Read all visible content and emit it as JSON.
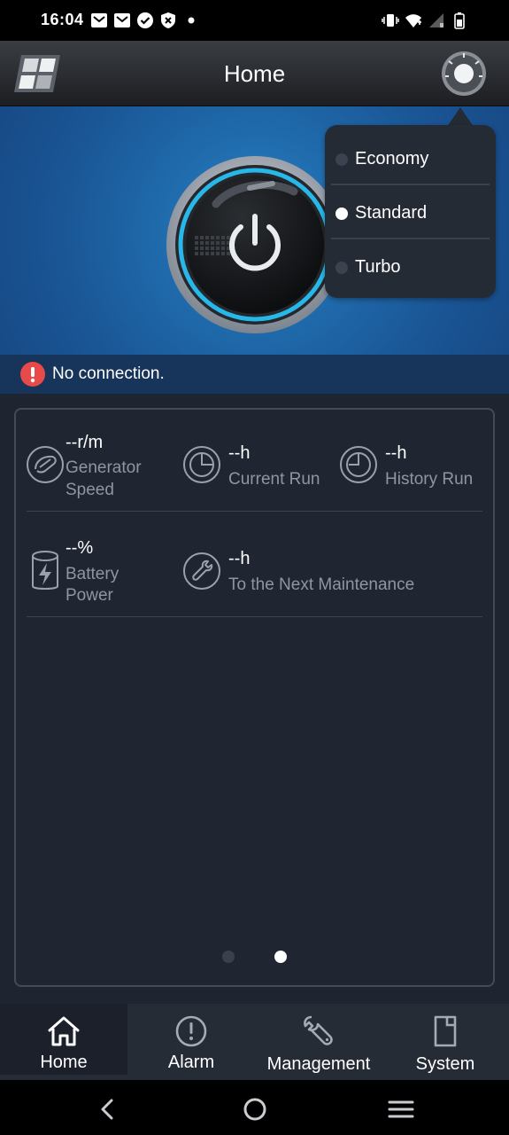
{
  "status_bar": {
    "time": "16:04",
    "left_icons": [
      "mail-icon",
      "mail-icon",
      "check-circle-icon",
      "shield-icon",
      "dot-icon"
    ],
    "right_icons": [
      "vibrate-icon",
      "wifi-icon",
      "signal-icon",
      "battery-icon"
    ]
  },
  "header": {
    "title": "Home"
  },
  "mode_menu": {
    "selected": "Standard",
    "options": [
      {
        "label": "Economy",
        "selected": false
      },
      {
        "label": "Standard",
        "selected": true
      },
      {
        "label": "Turbo",
        "selected": false
      }
    ]
  },
  "connection": {
    "message": "No connection."
  },
  "metrics": [
    {
      "value": "--r/m",
      "label_line1": "Generator",
      "label_line2": "Speed",
      "icon": "gauge-icon"
    },
    {
      "value": "--h",
      "label_line1": "Current Run",
      "label_line2": "",
      "icon": "clock-icon"
    },
    {
      "value": "--h",
      "label_line1": "History Run",
      "label_line2": "",
      "icon": "history-clock-icon"
    },
    {
      "value": "--%",
      "label_line1": "Battery",
      "label_line2": "Power",
      "icon": "battery-icon"
    },
    {
      "value": "--h",
      "label_line1": "To the Next Maintenance",
      "label_line2": "",
      "icon": "wrench-icon"
    }
  ],
  "pager": {
    "count": 2,
    "active_index": 1
  },
  "bottom_nav": [
    {
      "label": "Home",
      "icon": "home-icon",
      "active": true
    },
    {
      "label": "Alarm",
      "icon": "alert-icon",
      "active": false
    },
    {
      "label": "Management",
      "icon": "wrench-icon",
      "active": false
    },
    {
      "label": "System",
      "icon": "device-icon",
      "active": false
    }
  ],
  "colors": {
    "accent_blue": "#1f6aab",
    "connection_bar": "#17345a",
    "alert_red": "#e84a4a",
    "panel_bg": "#1f2631",
    "label_gray": "#8f96a0"
  }
}
